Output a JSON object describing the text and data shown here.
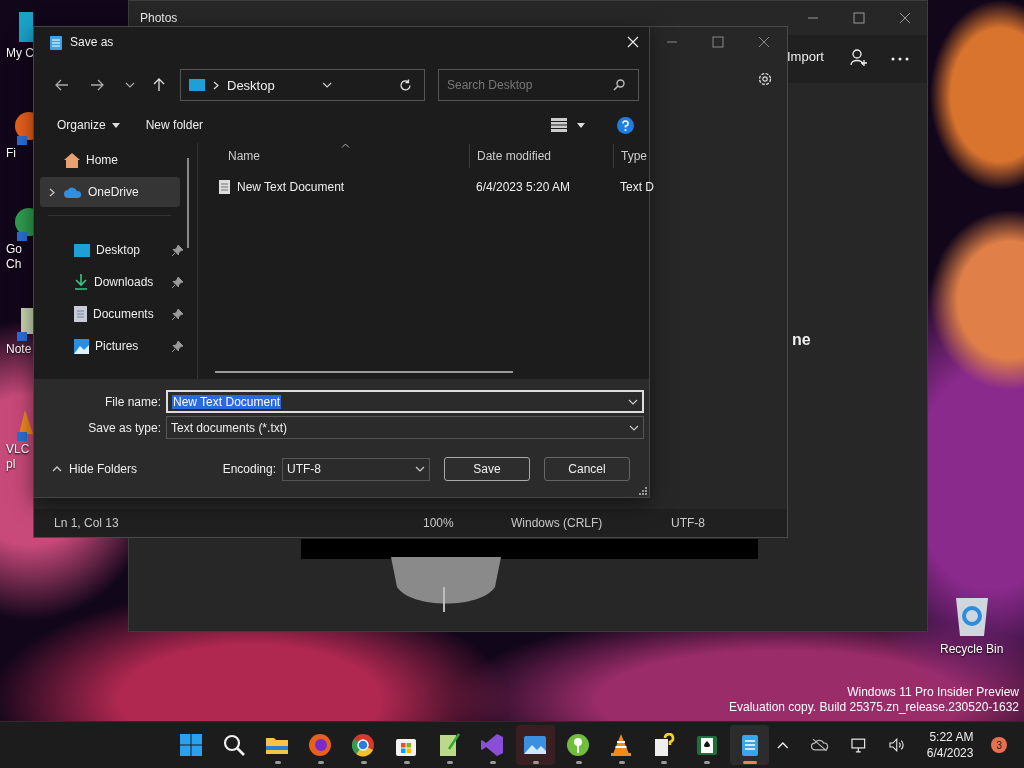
{
  "desktop": {
    "icons": [
      {
        "lines": [
          "My C"
        ]
      },
      {
        "lines": [
          "Fi"
        ]
      },
      {
        "lines": [
          "Go",
          "Ch"
        ]
      },
      {
        "lines": [
          "Note"
        ]
      },
      {
        "lines": [
          "VLC",
          "pl"
        ]
      }
    ],
    "recycle_bin": "Recycle Bin",
    "system_notice": [
      "Windows 11 Pro Insider Preview",
      "Evaluation copy. Build 25375.zn_release.230520-1632"
    ]
  },
  "photos_window": {
    "title": "Photos",
    "import": "Import",
    "partial_heading": "ne"
  },
  "notepad_window": {
    "status_bar": [
      "Ln 1, Col 13",
      "100%",
      "Windows (CRLF)",
      "UTF-8"
    ]
  },
  "dialog": {
    "title": "Save as",
    "location": "Desktop",
    "search": {
      "placeholder": "Search Desktop"
    },
    "toolbar": {
      "organize": "Organize",
      "new_folder": "New folder"
    },
    "nav_top": [
      {
        "label": "Home",
        "selected": false,
        "has_children": false
      },
      {
        "label": "OneDrive",
        "selected": true,
        "has_children": true
      }
    ],
    "quick_access": [
      {
        "label": "Desktop",
        "selected": false,
        "pinned": true
      },
      {
        "label": "Downloads",
        "selected": false,
        "pinned": true
      },
      {
        "label": "Documents",
        "selected": false,
        "pinned": true
      },
      {
        "label": "Pictures",
        "selected": false,
        "pinned": true
      }
    ],
    "columns": [
      "Name",
      "Date modified",
      "Type"
    ],
    "rows": [
      {
        "cells": [
          "New Text Document",
          "6/4/2023 5:20 AM",
          "Text D"
        ]
      }
    ],
    "file_name": {
      "label": "File name:",
      "value": "New Text Document",
      "text_selected": true
    },
    "save_type": {
      "label": "Save as type:",
      "value": "Text documents (*.txt)"
    },
    "hide_folders": "Hide Folders",
    "encoding": {
      "label": "Encoding:",
      "value": "UTF-8"
    },
    "buttons": [
      "Save",
      "Cancel"
    ]
  },
  "taskbar": {
    "apps": [
      {
        "running": false,
        "selected": false,
        "attention": false
      },
      {
        "running": false,
        "selected": false,
        "attention": false
      },
      {
        "running": true,
        "selected": false,
        "attention": false
      },
      {
        "running": true,
        "selected": false,
        "attention": false
      },
      {
        "running": true,
        "selected": false,
        "attention": false
      },
      {
        "running": true,
        "selected": false,
        "attention": false
      },
      {
        "running": true,
        "selected": false,
        "attention": false
      },
      {
        "running": true,
        "selected": false,
        "attention": false
      },
      {
        "running": true,
        "selected": false,
        "attention": true
      },
      {
        "running": true,
        "selected": false,
        "attention": false
      },
      {
        "running": true,
        "selected": false,
        "attention": false
      },
      {
        "running": true,
        "selected": false,
        "attention": false
      },
      {
        "running": true,
        "selected": false,
        "attention": false
      },
      {
        "running": true,
        "selected": true,
        "attention": false
      }
    ],
    "time": "5:22 AM",
    "date": "6/4/2023",
    "notifications": "3"
  }
}
